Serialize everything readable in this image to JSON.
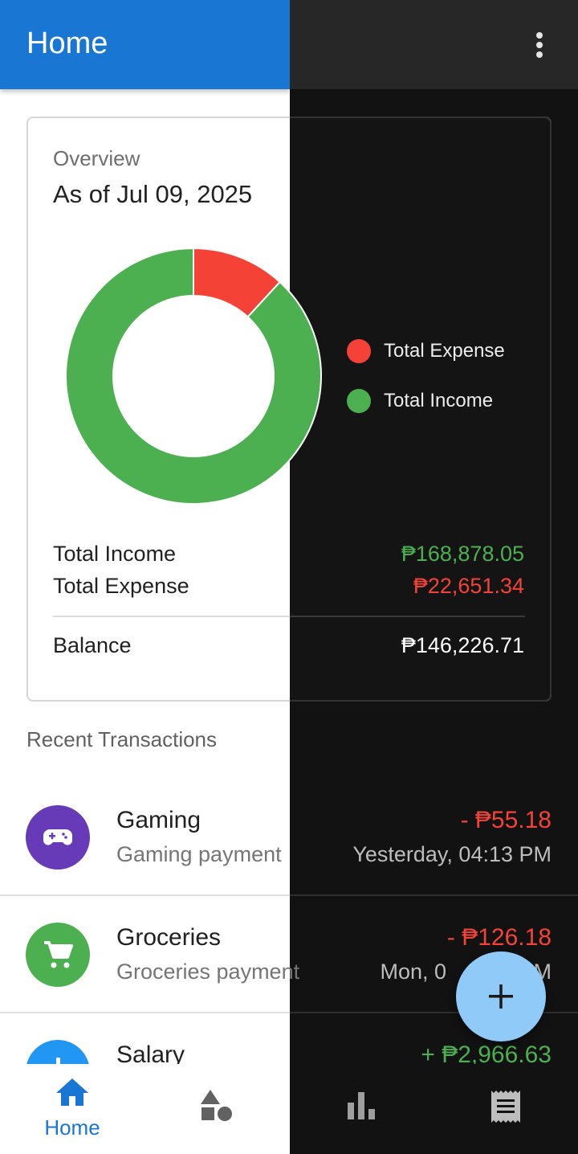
{
  "appbar": {
    "title": "Home"
  },
  "overview": {
    "label": "Overview",
    "date": "As of Jul 09, 2025",
    "legend": [
      {
        "label": "Total Expense",
        "color": "#f44336"
      },
      {
        "label": "Total Income",
        "color": "#4caf50"
      }
    ],
    "income_label": "Total Income",
    "income_value": "₱168,878.05",
    "expense_label": "Total Expense",
    "expense_value": "₱22,651.34",
    "balance_label": "Balance",
    "balance_value": "₱146,226.71"
  },
  "chart_data": {
    "type": "pie",
    "categories": [
      "Total Expense",
      "Total Income"
    ],
    "values": [
      22651.34,
      168878.05
    ],
    "colors": [
      "#f44336",
      "#4caf50"
    ]
  },
  "recent": {
    "title": "Recent Transactions",
    "items": [
      {
        "title": "Gaming",
        "desc": "Gaming payment",
        "amount": "- ₱55.18",
        "date": "Yesterday, 04:13 PM",
        "icon": "gamepad-icon",
        "color": "#673ab7",
        "amount_color": "#f44336"
      },
      {
        "title": "Groceries",
        "desc": "Groceries payment",
        "amount": "- ₱126.18",
        "date": "Mon, 0",
        "date_tail": "M",
        "icon": "cart-icon",
        "color": "#4caf50",
        "amount_color": "#f44336"
      },
      {
        "title": "Salary",
        "desc": "",
        "amount": "+ ₱2,966.63",
        "date": "",
        "icon": "salary-icon",
        "color": "#2196f3",
        "amount_color": "#4caf50"
      }
    ]
  },
  "fab": {
    "icon": "plus-icon",
    "color": "#90caf9"
  },
  "bottom_nav": {
    "items": [
      {
        "label": "Home",
        "icon": "home-icon",
        "active": true
      },
      {
        "label": "",
        "icon": "categories-icon",
        "active": false
      },
      {
        "label": "",
        "icon": "bar-chart-icon",
        "active": false
      },
      {
        "label": "",
        "icon": "receipt-icon",
        "active": false
      }
    ]
  }
}
